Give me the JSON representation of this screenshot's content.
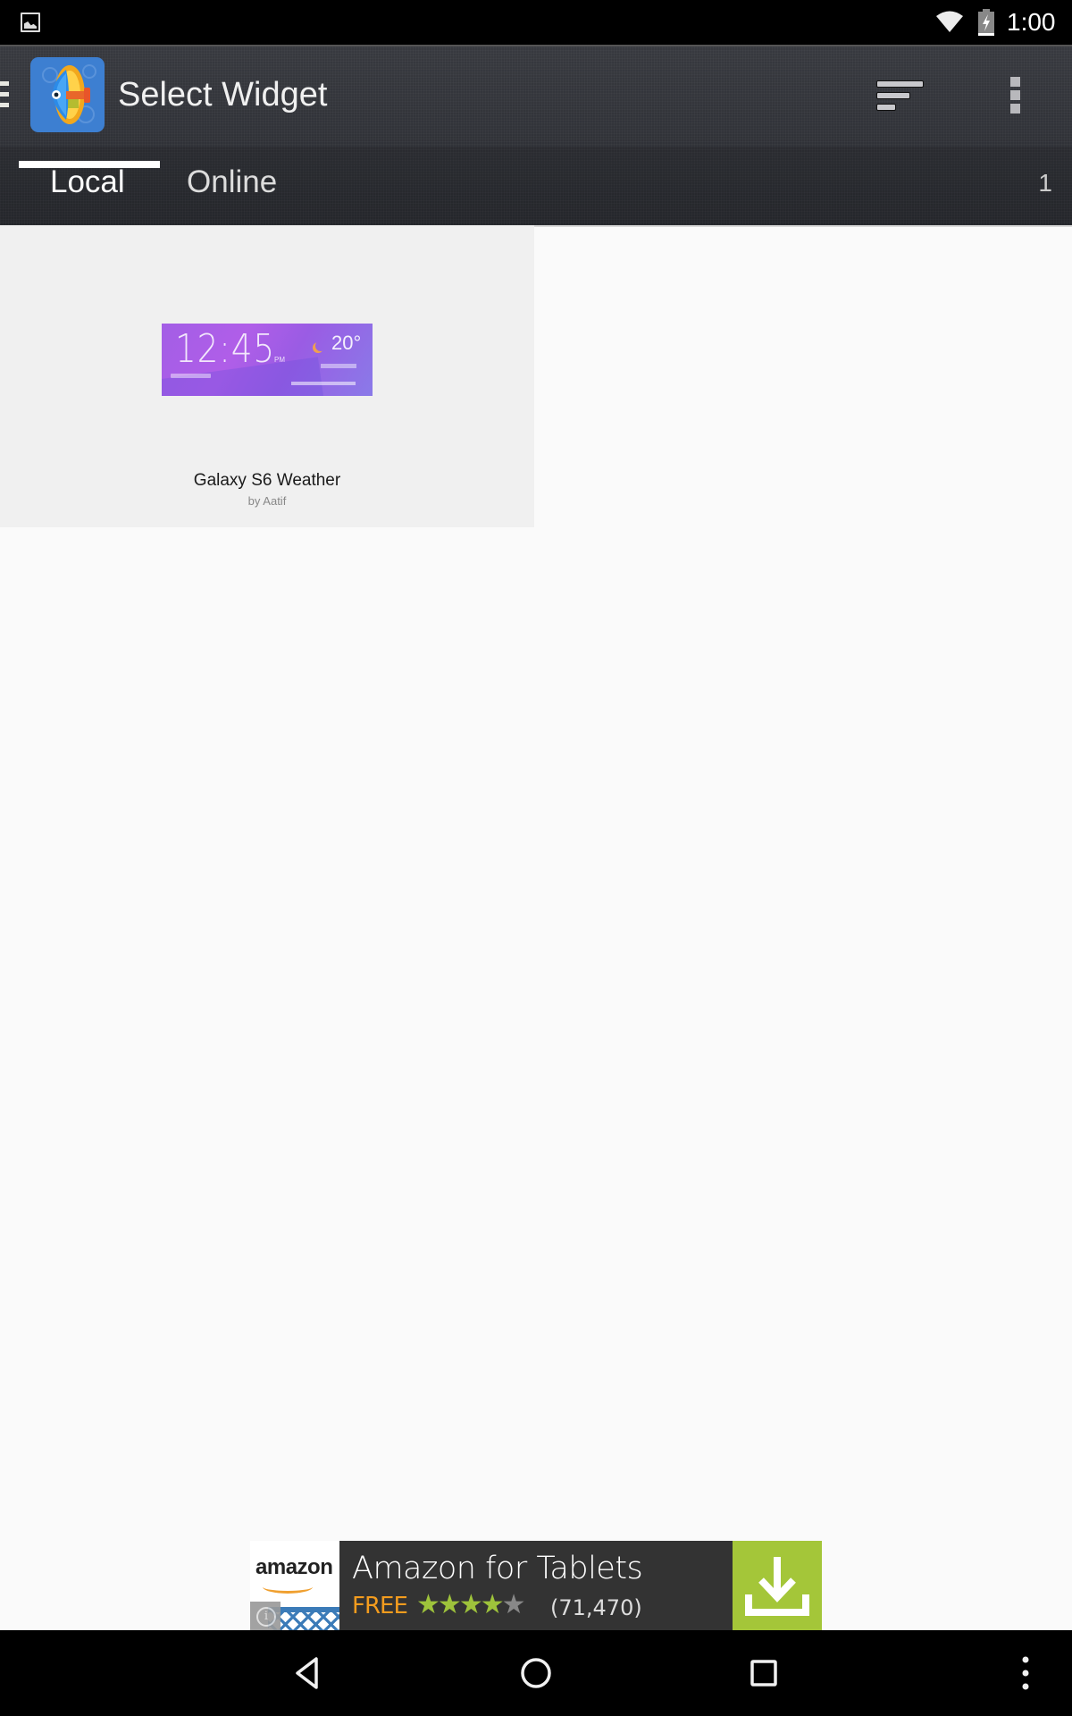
{
  "status_bar": {
    "time": "1:00",
    "icons": [
      "gallery-notification-icon",
      "wifi-icon",
      "battery-charging-icon"
    ]
  },
  "toolbar": {
    "title": "Select Widget",
    "icons": [
      "drawer-menu-icon",
      "app-icon",
      "sort-icon",
      "overflow-menu-icon"
    ]
  },
  "tabs": [
    {
      "label": "Local",
      "selected": true
    },
    {
      "label": "Online",
      "selected": false
    }
  ],
  "item_count": "1",
  "widgets": [
    {
      "name": "Galaxy S6 Weather",
      "author": "by Aatif",
      "preview": {
        "time": "12:45",
        "ampm": "PM",
        "temperature": "20°"
      }
    }
  ],
  "ad": {
    "brand": "amazon",
    "title": "Amazon for Tablets",
    "price": "FREE",
    "rating_stars": 4,
    "rating_max": 5,
    "reviews": "(71,470)",
    "info_symbol": "i",
    "accent": "#a4c639"
  },
  "nav_bar": {
    "buttons": [
      "back",
      "home",
      "recents",
      "menu"
    ]
  }
}
